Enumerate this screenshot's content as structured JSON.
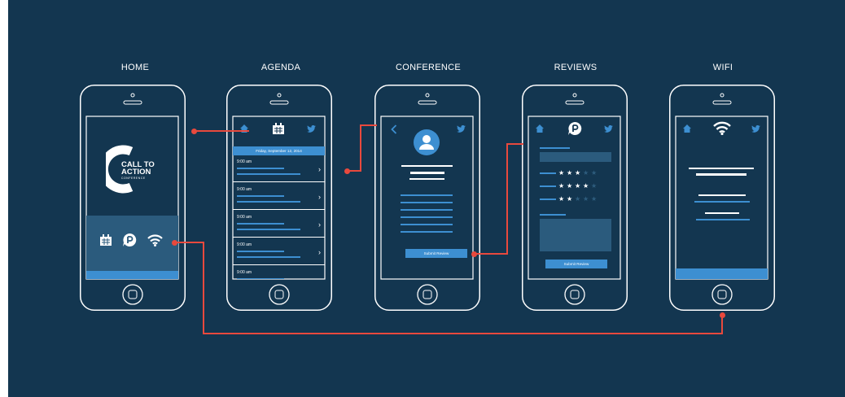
{
  "screens": {
    "home": {
      "title": "HOME",
      "logo_line1": "CALL TO",
      "logo_line2": "ACTION",
      "logo_line3": "CONFERENCE"
    },
    "agenda": {
      "title": "AGENDA",
      "date": "Friday, September 12, 2014",
      "rows": [
        {
          "time": "9:00 am"
        },
        {
          "time": "9:00 am"
        },
        {
          "time": "9:00 am"
        },
        {
          "time": "9:00 am"
        },
        {
          "time": "9:00 am"
        }
      ],
      "chevron": "›"
    },
    "conference": {
      "title": "CONFERENCE",
      "button": "Submit Review"
    },
    "reviews": {
      "title": "REVIEWS",
      "button": "Submit Review",
      "ratings": [
        3,
        4,
        2
      ],
      "max_rating": 5
    },
    "wifi": {
      "title": "WIFI"
    }
  },
  "colors": {
    "background": "#133650",
    "outline": "#ffffff",
    "accent": "#3d8fd1",
    "connector": "#e8493d",
    "panel": "#2b5b7d"
  },
  "icons": [
    "home-icon",
    "calendar-icon",
    "twitter-icon",
    "back-chevron-icon",
    "avatar-icon",
    "review-bubble-icon",
    "wifi-icon",
    "star-icon"
  ]
}
